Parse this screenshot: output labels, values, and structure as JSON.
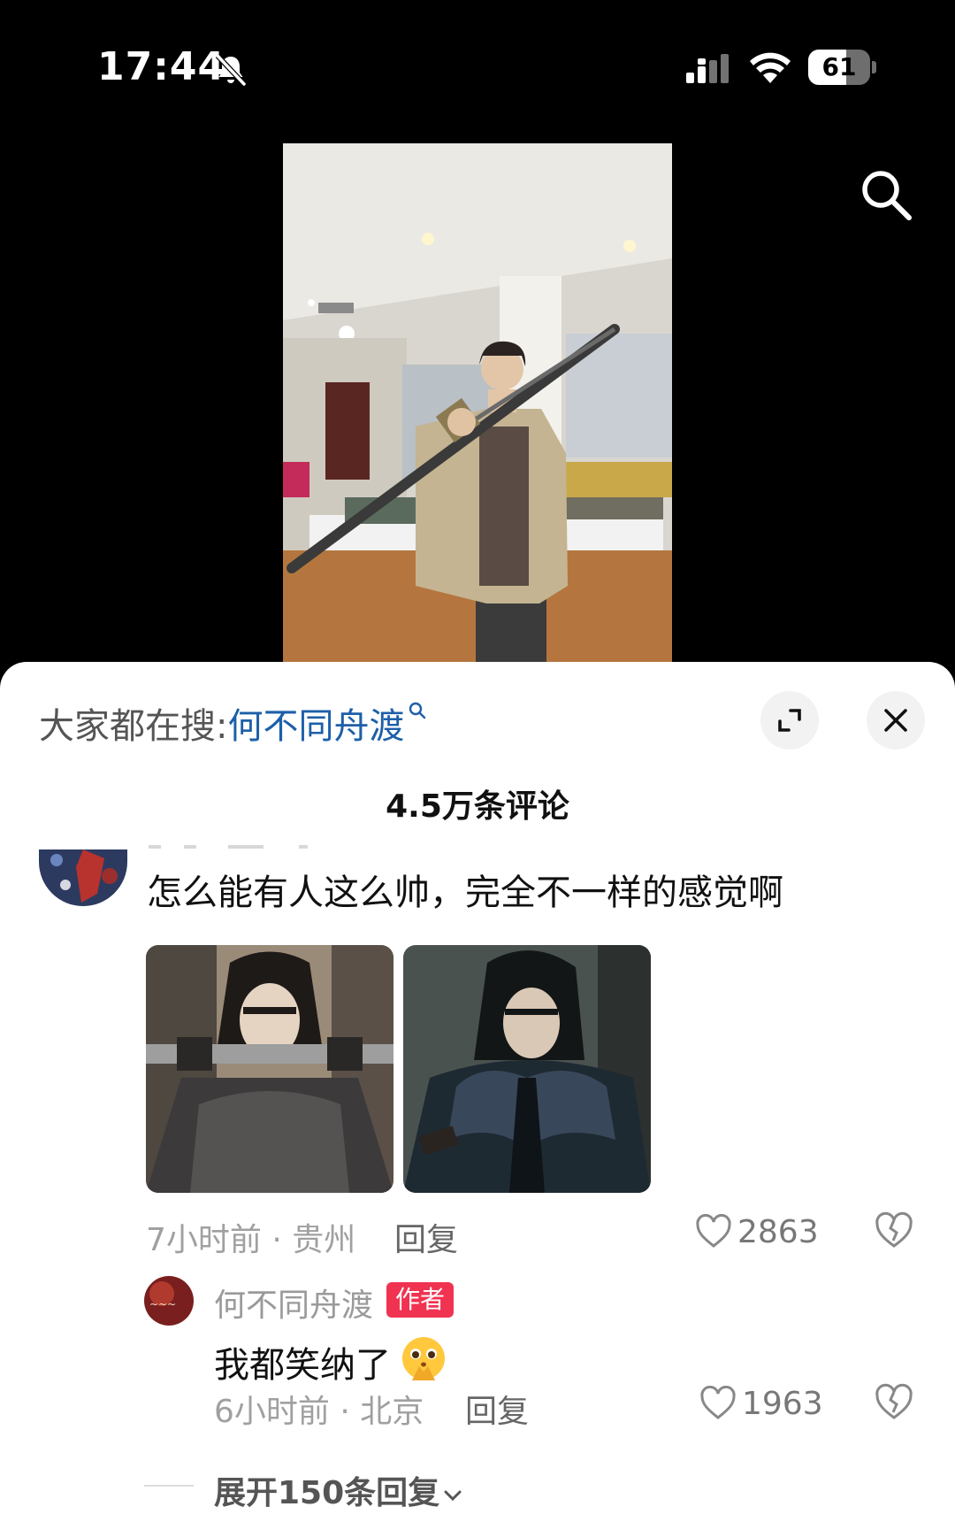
{
  "status_bar": {
    "time": "17:44",
    "battery": "61",
    "battery_level": 0.61
  },
  "video": {
    "search_icon": "search-icon"
  },
  "sheet": {
    "trend_prefix": "大家都在搜:",
    "trend_keyword": "何不同舟渡",
    "comment_count": "4.5万条评论",
    "comments": [
      {
        "text": "怎么能有人这么帅，完全不一样的感觉啊",
        "time_location": "7小时前 · 贵州",
        "reply_label": "回复",
        "likes": "2863",
        "image_count": 2
      },
      {
        "author": "何不同舟渡",
        "badge": "作者",
        "text": "我都笑纳了",
        "emoji": "pleading-hands-emoji",
        "time_location": "6小时前 · 北京",
        "reply_label": "回复",
        "likes": "1963"
      }
    ],
    "expand_replies": "展开150条回复"
  },
  "colors": {
    "keyword": "#1d5fa8",
    "badge": "#f03350",
    "background": "#000000",
    "sheet": "#ffffff"
  }
}
